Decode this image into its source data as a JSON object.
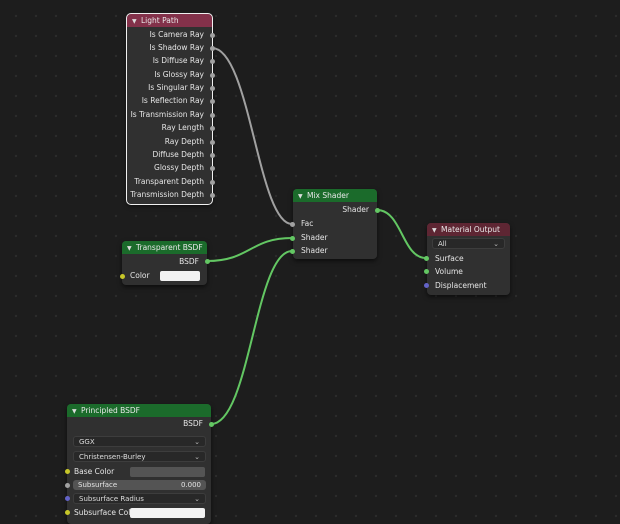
{
  "nodes": {
    "light_path": {
      "title": "Light Path",
      "outputs": [
        "Is Camera Ray",
        "Is Shadow Ray",
        "Is Diffuse Ray",
        "Is Glossy Ray",
        "Is Singular Ray",
        "Is Reflection Ray",
        "Is Transmission Ray",
        "Ray Length",
        "Ray Depth",
        "Diffuse Depth",
        "Glossy Depth",
        "Transparent Depth",
        "Transmission Depth"
      ]
    },
    "transparent_bsdf": {
      "title": "Transparent BSDF",
      "output": "BSDF",
      "color_label": "Color"
    },
    "mix_shader": {
      "title": "Mix Shader",
      "output": "Shader",
      "inputs": [
        "Fac",
        "Shader",
        "Shader"
      ]
    },
    "material_output": {
      "title": "Material Output",
      "target": "All",
      "inputs": [
        "Surface",
        "Volume",
        "Displacement"
      ]
    },
    "principled_bsdf": {
      "title": "Principled BSDF",
      "output": "BSDF",
      "distribution": "GGX",
      "subsurface_method": "Christensen-Burley",
      "base_color_label": "Base Color",
      "subsurface_label": "Subsurface",
      "subsurface_value": "0.000",
      "subsurface_radius_label": "Subsurface Radius",
      "subsurface_color_label": "Subsurface Colo"
    }
  },
  "colors": {
    "background": "#1d1d1d",
    "node_body": "#303030",
    "header_input": "#83314a",
    "header_shader": "#1b6b2b",
    "header_output": "#5e2633",
    "socket_shader": "#63c763",
    "socket_value": "#a1a1a1",
    "socket_color": "#c7c729",
    "socket_vector": "#6363c7"
  },
  "icons": {
    "collapse": "chevron-down-icon",
    "dropdown": "chevron-down-icon"
  }
}
